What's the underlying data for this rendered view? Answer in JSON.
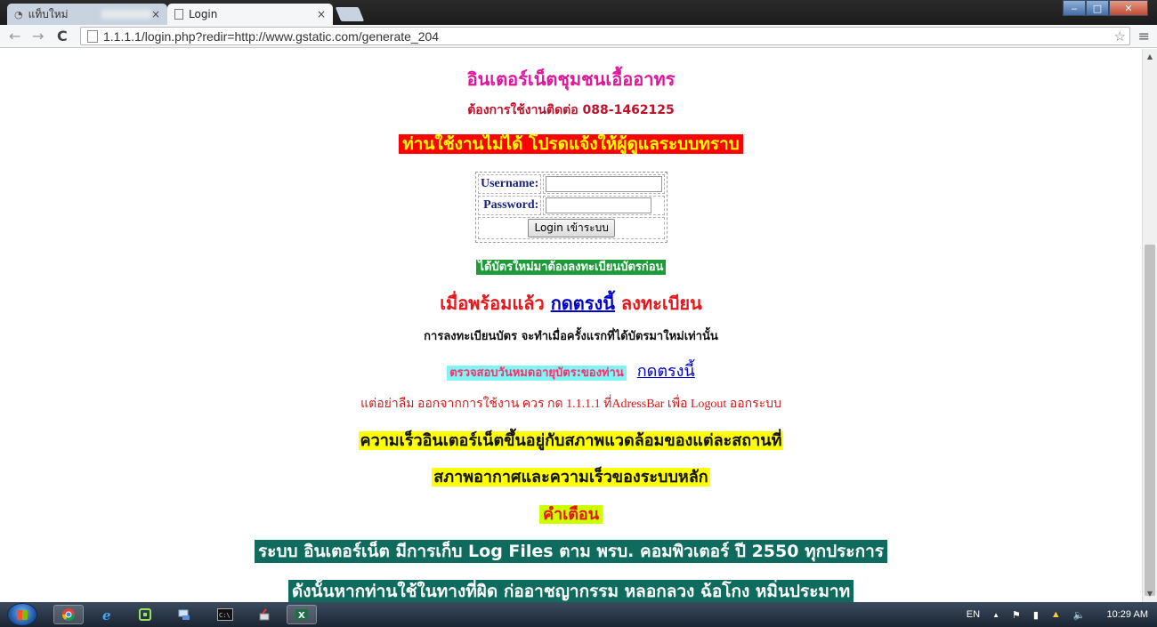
{
  "browser": {
    "tabs": [
      {
        "label": "แท็บใหม่",
        "active": false
      },
      {
        "label": "Login",
        "active": true
      }
    ],
    "tab_close_glyph": "×",
    "url": "1.1.1.1/login.php?redir=http://www.gstatic.com/generate_204",
    "nav": {
      "back": "←",
      "forward": "→",
      "reload": "C"
    },
    "star_glyph": "☆",
    "menu_glyph": "≡",
    "window_buttons": {
      "minimize": "‒",
      "maximize": "□",
      "close": "✕"
    }
  },
  "page": {
    "title": "อินเตอร์เน็ตชุมชนเอื้ออาทร",
    "contact": "ต้องการใช้งานติดต่อ  088-1462125",
    "warning": "ท่านใช้งานไม่ได้ โปรดแจ้งให้ผู้ดูแลระบบทราบ",
    "login": {
      "username_label": "Username:",
      "password_label": "Password:",
      "username_value": "",
      "password_value": "",
      "submit_label": "Login เข้าระบบ"
    },
    "new_card_notice": "ได้บัตรใหม่มาต้องลงทะเบียนบัตรก่อน",
    "ready": {
      "before": "เมื่อพร้อมแล้ว ",
      "link": "กดตรงนี้",
      "after": " ลงทะเบียน"
    },
    "first_time_note": "การลงทะเบียนบัตร จะทำเมื่อครั้งแรกที่ได้บัตรมาใหม่เท่านั้น",
    "expire": {
      "label": "ตรวจสอบวันหมดอายุบัตร:ของท่าน",
      "link": "กดตรงนี้"
    },
    "logout_note": "แต่อย่าลืม ออกจากการใช้งาน ควร กด 1.1.1.1 ที่AdressBar เพื่อ Logout ออกระบบ",
    "speed_line1": "ความเร็วอินเตอร์เน็ตขึ้นอยู่กับสภาพแวดล้อมของแต่ละสถานที่",
    "speed_line2": "สภาพอากาศและความเร็วของระบบหลัก",
    "caution_title": "คำเตือน",
    "log_line1": "ระบบ อินเตอร์เน็ต มีการเก็บ Log Files ตาม พรบ. คอมพิวเตอร์ ปี 2550 ทุกประการ",
    "log_line2": "ดังนั้นหากท่านใช้ในทางที่ผิด ก่ออาชญากรรม หลอกลวง ฉ้อโกง หมิ่นประมาท"
  },
  "taskbar": {
    "apps": [
      "chrome-icon",
      "ie-icon",
      "app-icon",
      "network-icon",
      "cmd-icon",
      "tool-icon",
      "excel-icon"
    ],
    "language": "EN",
    "clock": "10:29 AM",
    "tray_arrow": "▲"
  },
  "colors": {
    "title": "#e0169b",
    "warning_bg": "#ff0000",
    "warning_fg": "#ffff00",
    "green_bg": "#1f9a3a",
    "link": "#0000cc",
    "cyan_bg": "#7ff5f5",
    "yellow_bg": "#ffff00",
    "caution_bg": "#ccff00",
    "teal_bg": "#0f6b5e"
  }
}
